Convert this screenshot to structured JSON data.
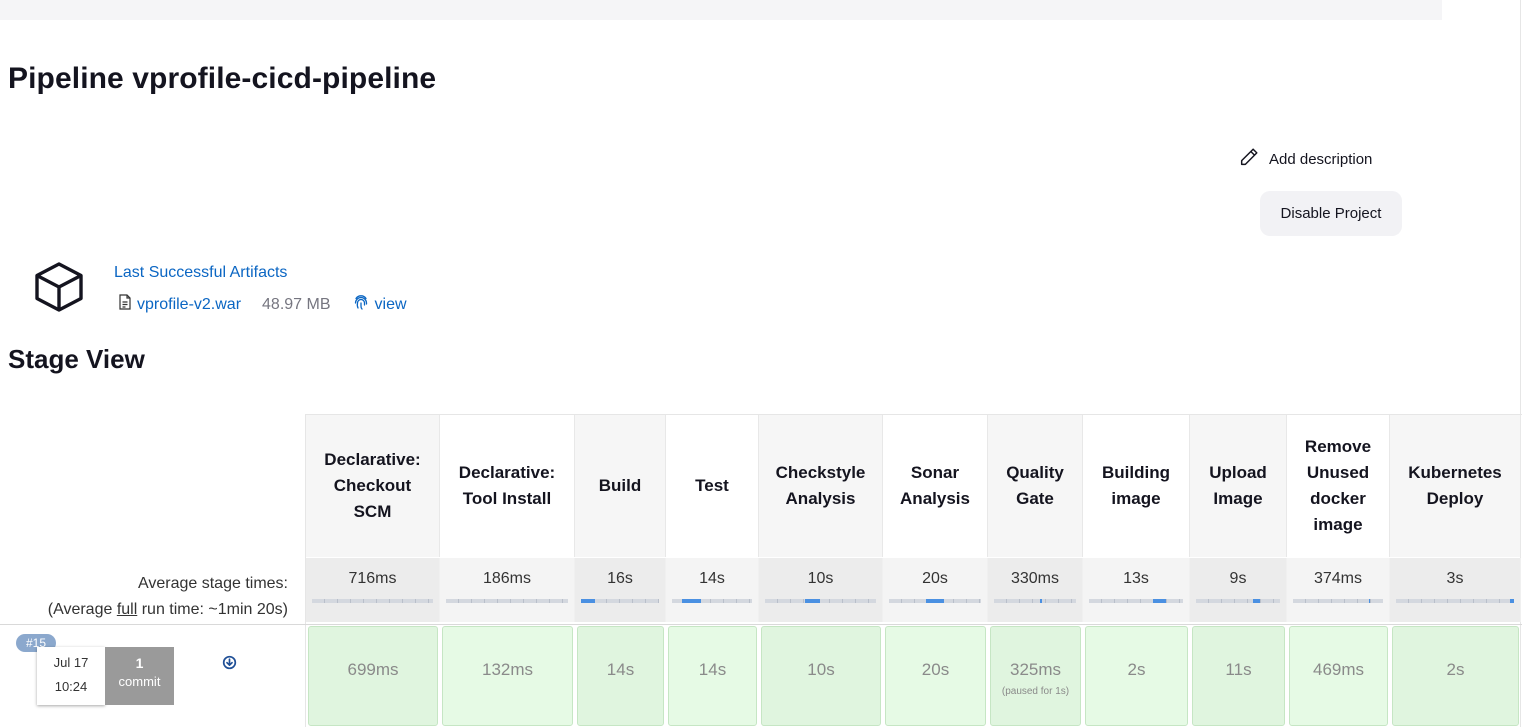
{
  "page": {
    "title": "Pipeline vprofile-cicd-pipeline",
    "add_description": "Add description",
    "disable_project": "Disable Project"
  },
  "artifacts": {
    "heading": "Last Successful Artifacts",
    "file": "vprofile-v2.war",
    "size": "48.97 MB",
    "view": "view"
  },
  "stage_view": {
    "title": "Stage View",
    "avg_stage_label": "Average stage times:",
    "avg_full_prefix": "(Average ",
    "avg_full_word": "full",
    "avg_full_suffix": " run time: ~1min 20s)",
    "stages": [
      {
        "name": "Declarative: Checkout SCM",
        "avg": "716ms",
        "result": "699ms"
      },
      {
        "name": "Declarative: Tool Install",
        "avg": "186ms",
        "result": "132ms"
      },
      {
        "name": "Build",
        "avg": "16s",
        "result": "14s"
      },
      {
        "name": "Test",
        "avg": "14s",
        "result": "14s"
      },
      {
        "name": "Checkstyle Analysis",
        "avg": "10s",
        "result": "10s"
      },
      {
        "name": "Sonar Analysis",
        "avg": "20s",
        "result": "20s"
      },
      {
        "name": "Quality Gate",
        "avg": "330ms",
        "result": "325ms",
        "note": "(paused for 1s)"
      },
      {
        "name": "Building image",
        "avg": "13s",
        "result": "2s"
      },
      {
        "name": "Upload Image",
        "avg": "9s",
        "result": "11s"
      },
      {
        "name": "Remove Unused docker image",
        "avg": "374ms",
        "result": "469ms"
      },
      {
        "name": "Kubernetes Deploy",
        "avg": "3s",
        "result": "2s"
      }
    ],
    "run": {
      "number": "#15",
      "date": "Jul 17",
      "time": "10:24",
      "commit_count": "1",
      "commit_word": "commit"
    }
  },
  "colors": {
    "link": "#0b66c3",
    "success_cell": "#e0f5df",
    "progress": "#4a90e2",
    "run_badge": "#8ba8cd"
  }
}
